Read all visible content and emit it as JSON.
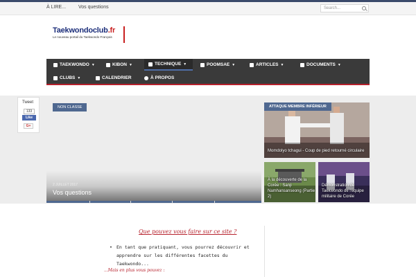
{
  "topbar": {
    "links": [
      "À LIRE...",
      "Vos questions"
    ],
    "search_placeholder": "Search..."
  },
  "logo": {
    "part1": "Taekwondo",
    "part2": "club",
    "part3": ".fr",
    "tagline": "Le nouveau portail du Taekwondo Français"
  },
  "nav": {
    "items": [
      {
        "label": "TAEKWONDO",
        "icon": "info-icon"
      },
      {
        "label": "KIBON",
        "icon": "image-icon"
      },
      {
        "label": "TECHNIQUE",
        "icon": "image-icon"
      },
      {
        "label": "POOMSAE",
        "icon": "film-icon"
      },
      {
        "label": "ARTICLES",
        "icon": "news-icon"
      },
      {
        "label": "DOCUMENTS",
        "icon": "copy-icon"
      },
      {
        "label": "CLUBS",
        "icon": "home-icon"
      },
      {
        "label": "CALENDRIER",
        "icon": "calendar-icon"
      },
      {
        "label": "À PROPOS",
        "icon": "compass-icon"
      }
    ]
  },
  "share": {
    "tweet": "Tweet",
    "count": "133",
    "like": "Like",
    "gplus": "G+"
  },
  "feature": {
    "badge": "NON CLASSE",
    "date": "2 JUILLET 2017",
    "title": "Vos questions"
  },
  "cards": {
    "top": {
      "label": "ATTAQUE MEMBRE INFÉRIEUR",
      "caption": "Momdolyo tchagui - Coup de pied retourné circulaire"
    },
    "left": {
      "caption": "À la découverte de la Corée : Sanji Namhansanseong (Partie 2)"
    },
    "right": {
      "caption": "Démonstration de Taekwondo de l'équipe militaire de Corée"
    }
  },
  "content": {
    "question": "Que pouvez vous faire sur ce site ?",
    "bullet": "En tant que pratiquant, vous pourrez découvrir et apprendre sur les différentes facettes du Taekwondo...",
    "more": "...Mais en plus vous pouvez :"
  }
}
